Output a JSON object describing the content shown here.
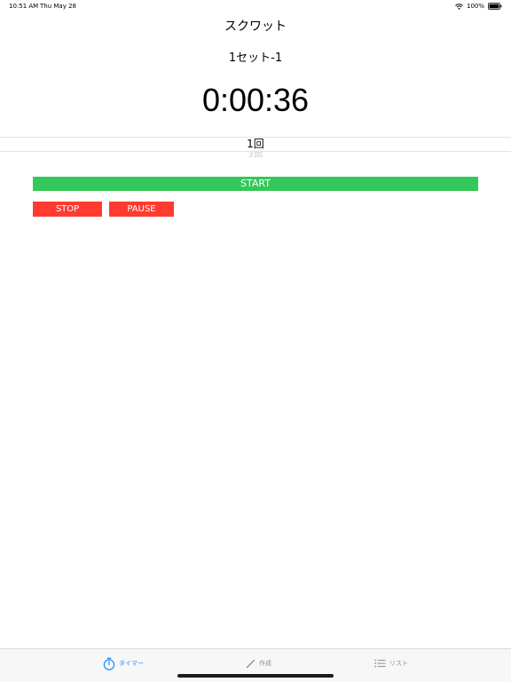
{
  "status_bar": {
    "time": "10:51 AM",
    "date": "Thu May 28",
    "battery": "100%",
    "wifi_icon": "wifi-icon",
    "battery_icon": "battery-full-icon"
  },
  "header": {
    "exercise_title": "スクワット",
    "set_label": "1セット-1",
    "timer": "0:00:36"
  },
  "picker": {
    "selected": "1回",
    "next": "2回"
  },
  "buttons": {
    "start": "START",
    "stop": "STOP",
    "pause": "PAUSE"
  },
  "tab_bar": {
    "items": [
      {
        "label": "タイマー",
        "icon": "stopwatch-icon",
        "active": true
      },
      {
        "label": "作成",
        "icon": "pencil-icon",
        "active": false
      },
      {
        "label": "リスト",
        "icon": "list-icon",
        "active": false
      }
    ]
  },
  "colors": {
    "start": "#34c759",
    "stop": "#ff3b30",
    "pause": "#ff3b30",
    "tab_active": "#1a8cff",
    "tab_inactive": "#8e8e93"
  }
}
